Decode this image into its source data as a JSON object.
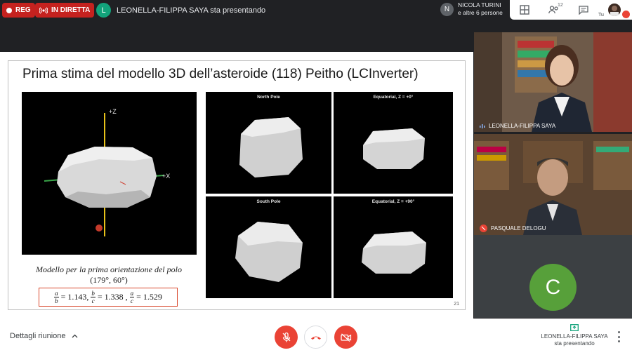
{
  "top": {
    "rec_label": "REG",
    "live_label": "IN DIRETTA",
    "presenter_initial": "L",
    "presenter_status": "LEONELLA-FILIPPA SAYA sta presentando",
    "participants_initial": "N",
    "participants_name": "NICOLA TURINI",
    "participants_more": "e altre 6 persone",
    "people_count": "12",
    "self_label": "Tu"
  },
  "slide": {
    "title": "Prima stima del modello 3D dell’asteroide (118) Peitho (LCInverter)",
    "axis_z": "+Z",
    "axis_x": "+X",
    "views": [
      {
        "label": "North Pole"
      },
      {
        "label": "Equatorial, Z = +0°"
      },
      {
        "label": "South Pole"
      },
      {
        "label": "Equatorial, Z = +90°"
      }
    ],
    "caption_line1": "Modello per la prima orientazione del polo",
    "caption_line2": "(179°, 60°)",
    "ratios": [
      {
        "num": "a",
        "den": "b",
        "value": "= 1.143,"
      },
      {
        "num": "b",
        "den": "c",
        "value": "= 1.338 ,"
      },
      {
        "num": "a",
        "den": "c",
        "value": "= 1.529"
      }
    ],
    "page_number": "21"
  },
  "videos": [
    {
      "name": "LEONELLA-FILIPPA SAYA"
    },
    {
      "name": "PASQUALE DELOGU"
    },
    {
      "initial": "C"
    }
  ],
  "bottom": {
    "details_label": "Dettagli riunione",
    "presenting_name": "LEONELLA-FILIPPA SAYA",
    "presenting_status": "sta presentando"
  },
  "colors": {
    "danger": "#ea4335",
    "live_red": "#c5221f",
    "presenter_avatar": "#12a37b",
    "c_avatar": "#57a03a"
  }
}
